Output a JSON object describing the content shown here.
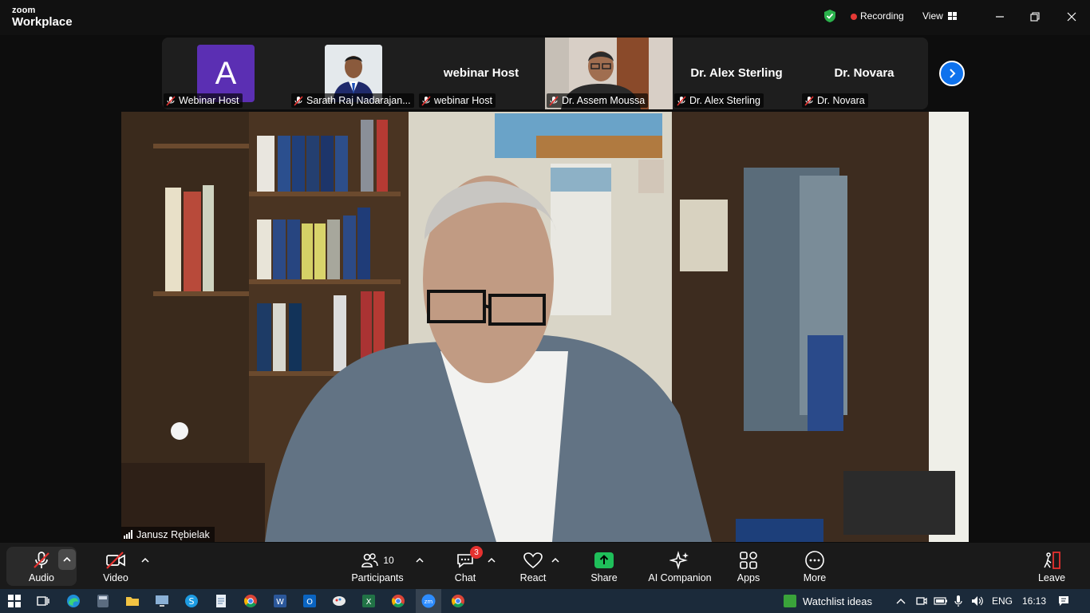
{
  "app": {
    "logo_line1": "zoom",
    "logo_line2": "Workplace",
    "recording_label": "Recording",
    "view_label": "View",
    "accent": "#0e72ed",
    "record_color": "#e53935"
  },
  "thumbnails": [
    {
      "display": "A",
      "name": "Webinar Host",
      "kind": "letter-avatar",
      "avatar_color": "#5b2fb3"
    },
    {
      "display": "",
      "name": "Sarath Raj Nadarajan...",
      "kind": "photo"
    },
    {
      "display": "webinar Host",
      "name": "webinar Host",
      "kind": "name-only"
    },
    {
      "display": "",
      "name": "Dr. Assem Moussa",
      "kind": "video"
    },
    {
      "display": "Dr. Alex Sterling",
      "name": "Dr. Alex Sterling",
      "kind": "name-only"
    },
    {
      "display": "Dr. Novara",
      "name": "Dr. Novara",
      "kind": "name-only"
    }
  ],
  "main_speaker": {
    "name": "Janusz Rębielak"
  },
  "toolbar": {
    "audio": "Audio",
    "video": "Video",
    "participants": "Participants",
    "participants_count": "10",
    "chat": "Chat",
    "chat_badge": "3",
    "react": "React",
    "share": "Share",
    "ai_companion": "AI Companion",
    "apps": "Apps",
    "more": "More",
    "leave": "Leave"
  },
  "taskbar": {
    "watchlist": "Watchlist ideas",
    "language": "ENG",
    "time": "16:13",
    "apps": [
      "windows-start",
      "task-view",
      "edge",
      "calculator",
      "file-explorer",
      "remote-desktop",
      "skype",
      "notepad",
      "chrome",
      "word",
      "outlook",
      "paint",
      "excel",
      "chrome-alt",
      "zoom",
      "chrome-profile"
    ]
  }
}
